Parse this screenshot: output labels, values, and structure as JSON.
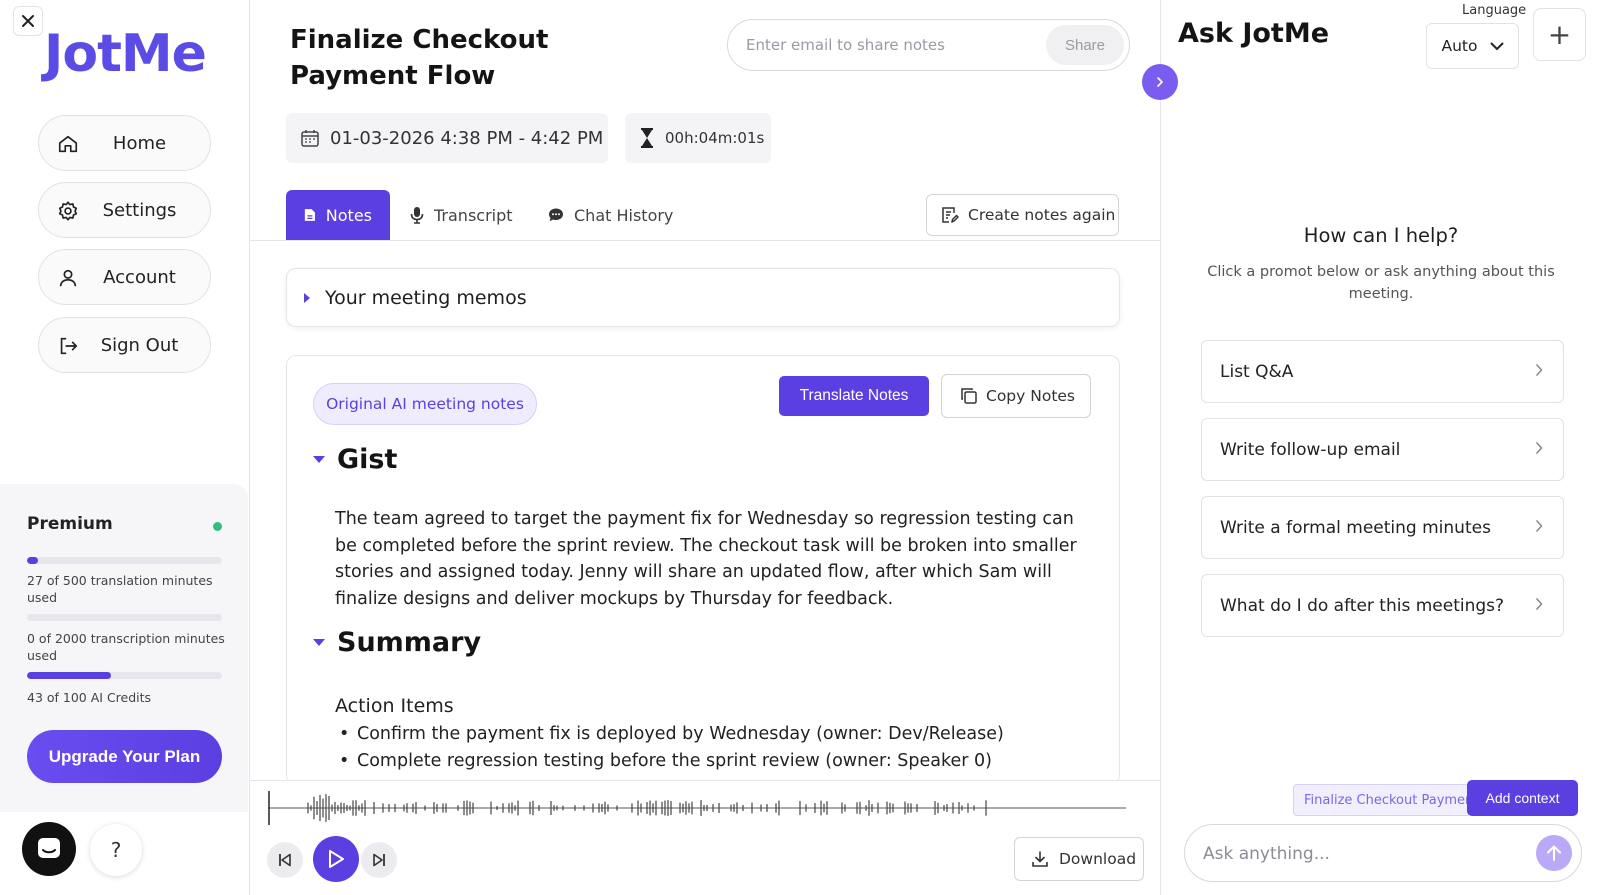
{
  "sidebar": {
    "logo": "JotMe",
    "nav": [
      {
        "label": "Home",
        "icon": "home-icon"
      },
      {
        "label": "Settings",
        "icon": "gear-icon"
      },
      {
        "label": "Account",
        "icon": "user-icon"
      },
      {
        "label": "Sign Out",
        "icon": "sign-out-icon"
      }
    ],
    "plan": {
      "name": "Premium",
      "status_color": "#2fbf7f",
      "translation": {
        "text": "27 of 500 translation minutes used",
        "progress": 0.054
      },
      "transcription": {
        "text": "0 of 2000 transcription minutes used",
        "progress": 0.0
      },
      "ai_credits": {
        "text": "43 of 100 AI Credits",
        "progress": 0.43
      },
      "upgrade_label": "Upgrade Your Plan"
    },
    "help_label": "?"
  },
  "meeting": {
    "title": "Finalize Checkout Payment Flow",
    "share": {
      "placeholder": "Enter email to share notes",
      "button": "Share"
    },
    "datetime": "01-03-2026 4:38 PM - 4:42 PM",
    "duration": "00h:04m:01s"
  },
  "tabs": [
    {
      "label": "Notes",
      "active": true
    },
    {
      "label": "Transcript",
      "active": false
    },
    {
      "label": "Chat History",
      "active": false
    }
  ],
  "create_again_label": "Create notes again",
  "memos_label": "Your meeting memos",
  "notes": {
    "badge": "Original AI meeting notes",
    "translate_label": "Translate Notes",
    "copy_label": "Copy Notes",
    "gist_heading": "Gist",
    "gist_text": "The team agreed to target the payment fix for Wednesday so regression testing can be completed before the sprint review. The checkout task will be broken into smaller stories and assigned today. Jenny will share an updated flow, after which Sam will finalize designs and deliver mockups by Thursday for feedback.",
    "summary_heading": "Summary",
    "action_items_heading": "Action Items",
    "action_items": [
      "Confirm the payment fix is deployed by Wednesday (owner: Dev/Release)",
      "Complete regression testing before the sprint review (owner: Speaker 0)"
    ]
  },
  "player": {
    "download_label": "Download"
  },
  "assistant": {
    "title": "Ask JotMe",
    "language_label": "Language",
    "language_value": "Auto",
    "new_label": "+",
    "help_title": "How can I help?",
    "help_subtitle": "Click a promot below or ask anything about this meeting.",
    "prompts": [
      "List Q&A",
      "Write follow-up email",
      "Write a formal meeting minutes",
      "What do I do after this meetings?"
    ],
    "context_chip": "Finalize Checkout Payment Flow",
    "add_context_label": "Add context",
    "input_placeholder": "Ask anything..."
  },
  "colors": {
    "accent": "#5b3fe0",
    "accent_light": "#efedfd",
    "success": "#2fbf7f"
  }
}
